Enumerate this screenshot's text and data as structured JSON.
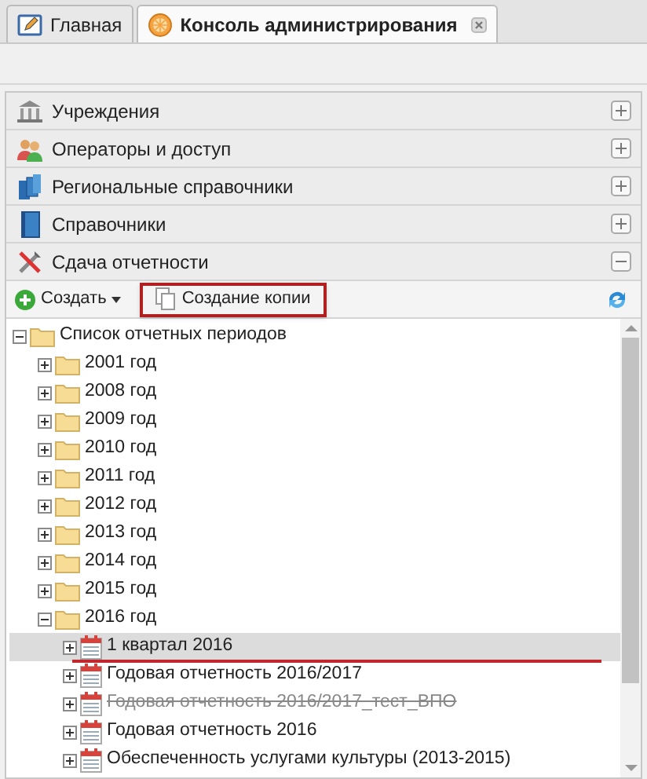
{
  "tabs": [
    {
      "label": "Главная",
      "selected": false,
      "closable": false
    },
    {
      "label": "Консоль администрирования",
      "selected": true,
      "closable": true
    }
  ],
  "sections": [
    {
      "label": "Учреждения",
      "expanded": false
    },
    {
      "label": "Операторы и доступ",
      "expanded": false
    },
    {
      "label": "Региональные справочники",
      "expanded": false
    },
    {
      "label": "Справочники",
      "expanded": false
    },
    {
      "label": "Сдача отчетности",
      "expanded": true
    }
  ],
  "toolbar": {
    "create": {
      "label": "Создать"
    },
    "copy": {
      "label": "Создание копии",
      "highlighted": true
    }
  },
  "tree": [
    {
      "label": "Список отчетных периодов",
      "kind": "folder",
      "expanded": true,
      "children": [
        {
          "label": "2001 год",
          "kind": "folder",
          "expanded": false
        },
        {
          "label": "2008 год",
          "kind": "folder",
          "expanded": false
        },
        {
          "label": "2009 год",
          "kind": "folder",
          "expanded": false
        },
        {
          "label": "2010 год",
          "kind": "folder",
          "expanded": false
        },
        {
          "label": "2011 год",
          "kind": "folder",
          "expanded": false
        },
        {
          "label": "2012 год",
          "kind": "folder",
          "expanded": false
        },
        {
          "label": "2013 год",
          "kind": "folder",
          "expanded": false
        },
        {
          "label": "2014 год",
          "kind": "folder",
          "expanded": false
        },
        {
          "label": "2015 год",
          "kind": "folder",
          "expanded": false
        },
        {
          "label": "2016 год",
          "kind": "folder",
          "expanded": true,
          "children": [
            {
              "label": "1 квартал 2016",
              "kind": "period",
              "expanded": false,
              "selected": true,
              "underlined": true,
              "disabled": false
            },
            {
              "label": "Годовая отчетность 2016/2017",
              "kind": "period",
              "expanded": false,
              "selected": false,
              "underlined": false,
              "disabled": false
            },
            {
              "label": "Годовая отчетность 2016/2017_тест_ВПО",
              "kind": "period",
              "expanded": false,
              "selected": false,
              "underlined": false,
              "disabled": true
            },
            {
              "label": "Годовая отчетность 2016",
              "kind": "period",
              "expanded": false,
              "selected": false,
              "underlined": false,
              "disabled": false
            },
            {
              "label": "Обеспеченность услугами культуры (2013-2015)",
              "kind": "period",
              "expanded": false,
              "selected": false,
              "underlined": false,
              "disabled": false
            }
          ]
        }
      ]
    }
  ]
}
